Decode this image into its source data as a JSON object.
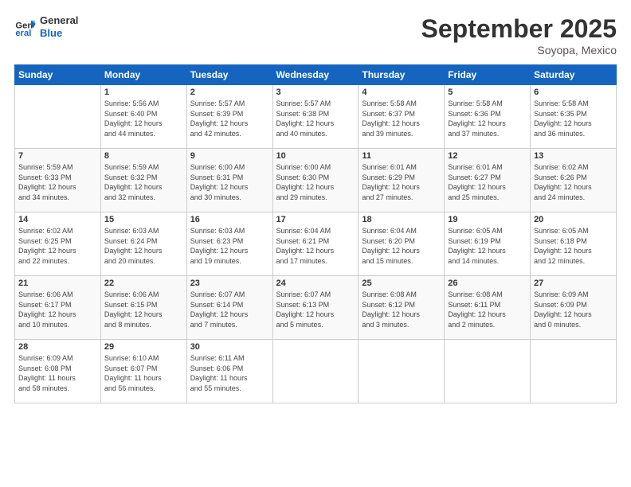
{
  "logo": {
    "line1": "General",
    "line2": "Blue"
  },
  "title": "September 2025",
  "subtitle": "Soyopa, Mexico",
  "days": [
    "Sunday",
    "Monday",
    "Tuesday",
    "Wednesday",
    "Thursday",
    "Friday",
    "Saturday"
  ],
  "weeks": [
    [
      {
        "day": "",
        "info": ""
      },
      {
        "day": "1",
        "info": "Sunrise: 5:56 AM\nSunset: 6:40 PM\nDaylight: 12 hours\nand 44 minutes."
      },
      {
        "day": "2",
        "info": "Sunrise: 5:57 AM\nSunset: 6:39 PM\nDaylight: 12 hours\nand 42 minutes."
      },
      {
        "day": "3",
        "info": "Sunrise: 5:57 AM\nSunset: 6:38 PM\nDaylight: 12 hours\nand 40 minutes."
      },
      {
        "day": "4",
        "info": "Sunrise: 5:58 AM\nSunset: 6:37 PM\nDaylight: 12 hours\nand 39 minutes."
      },
      {
        "day": "5",
        "info": "Sunrise: 5:58 AM\nSunset: 6:36 PM\nDaylight: 12 hours\nand 37 minutes."
      },
      {
        "day": "6",
        "info": "Sunrise: 5:58 AM\nSunset: 6:35 PM\nDaylight: 12 hours\nand 36 minutes."
      }
    ],
    [
      {
        "day": "7",
        "info": "Sunrise: 5:59 AM\nSunset: 6:33 PM\nDaylight: 12 hours\nand 34 minutes."
      },
      {
        "day": "8",
        "info": "Sunrise: 5:59 AM\nSunset: 6:32 PM\nDaylight: 12 hours\nand 32 minutes."
      },
      {
        "day": "9",
        "info": "Sunrise: 6:00 AM\nSunset: 6:31 PM\nDaylight: 12 hours\nand 30 minutes."
      },
      {
        "day": "10",
        "info": "Sunrise: 6:00 AM\nSunset: 6:30 PM\nDaylight: 12 hours\nand 29 minutes."
      },
      {
        "day": "11",
        "info": "Sunrise: 6:01 AM\nSunset: 6:29 PM\nDaylight: 12 hours\nand 27 minutes."
      },
      {
        "day": "12",
        "info": "Sunrise: 6:01 AM\nSunset: 6:27 PM\nDaylight: 12 hours\nand 25 minutes."
      },
      {
        "day": "13",
        "info": "Sunrise: 6:02 AM\nSunset: 6:26 PM\nDaylight: 12 hours\nand 24 minutes."
      }
    ],
    [
      {
        "day": "14",
        "info": "Sunrise: 6:02 AM\nSunset: 6:25 PM\nDaylight: 12 hours\nand 22 minutes."
      },
      {
        "day": "15",
        "info": "Sunrise: 6:03 AM\nSunset: 6:24 PM\nDaylight: 12 hours\nand 20 minutes."
      },
      {
        "day": "16",
        "info": "Sunrise: 6:03 AM\nSunset: 6:23 PM\nDaylight: 12 hours\nand 19 minutes."
      },
      {
        "day": "17",
        "info": "Sunrise: 6:04 AM\nSunset: 6:21 PM\nDaylight: 12 hours\nand 17 minutes."
      },
      {
        "day": "18",
        "info": "Sunrise: 6:04 AM\nSunset: 6:20 PM\nDaylight: 12 hours\nand 15 minutes."
      },
      {
        "day": "19",
        "info": "Sunrise: 6:05 AM\nSunset: 6:19 PM\nDaylight: 12 hours\nand 14 minutes."
      },
      {
        "day": "20",
        "info": "Sunrise: 6:05 AM\nSunset: 6:18 PM\nDaylight: 12 hours\nand 12 minutes."
      }
    ],
    [
      {
        "day": "21",
        "info": "Sunrise: 6:06 AM\nSunset: 6:17 PM\nDaylight: 12 hours\nand 10 minutes."
      },
      {
        "day": "22",
        "info": "Sunrise: 6:06 AM\nSunset: 6:15 PM\nDaylight: 12 hours\nand 8 minutes."
      },
      {
        "day": "23",
        "info": "Sunrise: 6:07 AM\nSunset: 6:14 PM\nDaylight: 12 hours\nand 7 minutes."
      },
      {
        "day": "24",
        "info": "Sunrise: 6:07 AM\nSunset: 6:13 PM\nDaylight: 12 hours\nand 5 minutes."
      },
      {
        "day": "25",
        "info": "Sunrise: 6:08 AM\nSunset: 6:12 PM\nDaylight: 12 hours\nand 3 minutes."
      },
      {
        "day": "26",
        "info": "Sunrise: 6:08 AM\nSunset: 6:11 PM\nDaylight: 12 hours\nand 2 minutes."
      },
      {
        "day": "27",
        "info": "Sunrise: 6:09 AM\nSunset: 6:09 PM\nDaylight: 12 hours\nand 0 minutes."
      }
    ],
    [
      {
        "day": "28",
        "info": "Sunrise: 6:09 AM\nSunset: 6:08 PM\nDaylight: 11 hours\nand 58 minutes."
      },
      {
        "day": "29",
        "info": "Sunrise: 6:10 AM\nSunset: 6:07 PM\nDaylight: 11 hours\nand 56 minutes."
      },
      {
        "day": "30",
        "info": "Sunrise: 6:11 AM\nSunset: 6:06 PM\nDaylight: 11 hours\nand 55 minutes."
      },
      {
        "day": "",
        "info": ""
      },
      {
        "day": "",
        "info": ""
      },
      {
        "day": "",
        "info": ""
      },
      {
        "day": "",
        "info": ""
      }
    ]
  ]
}
